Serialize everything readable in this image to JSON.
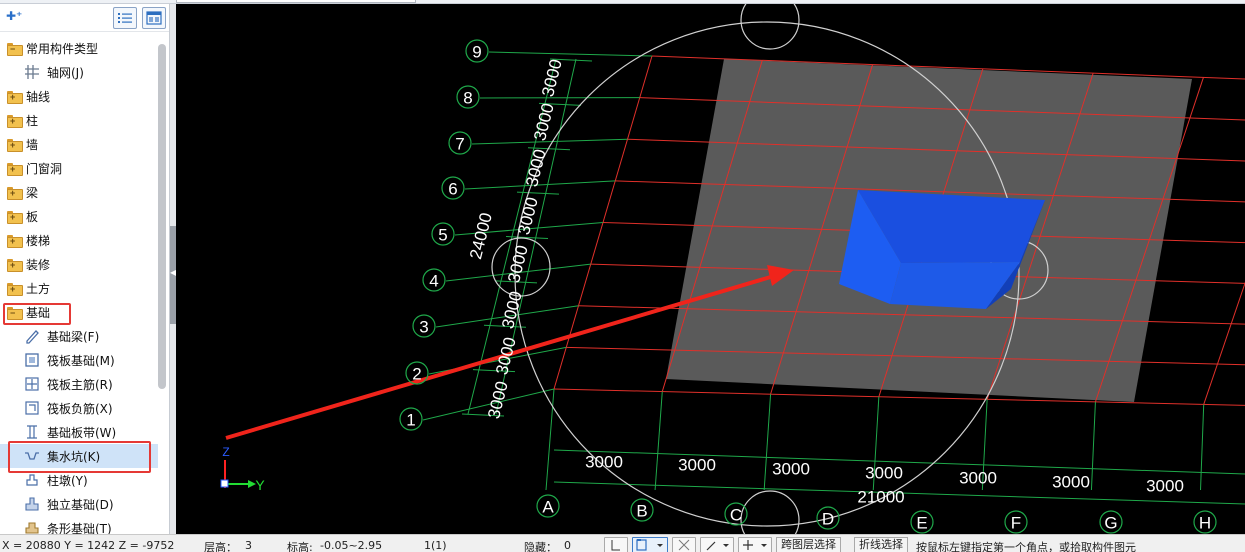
{
  "tree": {
    "items": [
      {
        "label": "常用构件类型",
        "icon": "folder-open-icon"
      },
      {
        "label": "轴网(J)",
        "icon": "grid-icon"
      },
      {
        "label": "轴线",
        "icon": "folder-icon"
      },
      {
        "label": "柱",
        "icon": "folder-icon"
      },
      {
        "label": "墙",
        "icon": "folder-icon"
      },
      {
        "label": "门窗洞",
        "icon": "folder-icon"
      },
      {
        "label": "梁",
        "icon": "folder-icon"
      },
      {
        "label": "板",
        "icon": "folder-icon"
      },
      {
        "label": "楼梯",
        "icon": "folder-icon"
      },
      {
        "label": "装修",
        "icon": "folder-icon"
      },
      {
        "label": "土方",
        "icon": "folder-icon"
      },
      {
        "label": "基础",
        "icon": "folder-open-icon"
      },
      {
        "label": "基础梁(F)",
        "icon": "pencil-icon"
      },
      {
        "label": "筏板基础(M)",
        "icon": "raft-icon"
      },
      {
        "label": "筏板主筋(R)",
        "icon": "rebar-icon"
      },
      {
        "label": "筏板负筋(X)",
        "icon": "neg-rebar-icon"
      },
      {
        "label": "基础板带(W)",
        "icon": "strip-icon"
      },
      {
        "label": "集水坑(K)",
        "icon": "sump-icon"
      },
      {
        "label": "柱墩(Y)",
        "icon": "pier-icon"
      },
      {
        "label": "独立基础(D)",
        "icon": "isolated-footing-icon"
      },
      {
        "label": "条形基础(T)",
        "icon": "strip-footing-icon"
      }
    ],
    "selected": "集水坑(K)"
  },
  "viewport": {
    "row_axes": [
      "1",
      "2",
      "3",
      "4",
      "5",
      "6",
      "7",
      "8",
      "9"
    ],
    "col_axes": [
      "A",
      "B",
      "C",
      "D",
      "E",
      "F",
      "G",
      "H"
    ],
    "col_dims": [
      "3000",
      "3000",
      "3000",
      "3000",
      "3000",
      "3000",
      "3000"
    ],
    "col_total": "21000",
    "row_dims": [
      "3000",
      "3000",
      "3000",
      "3000",
      "3000",
      "3000",
      "3000",
      "3000"
    ],
    "row_total": "24000",
    "axis_labels": {
      "z": "Z",
      "y": "Y"
    },
    "colors": {
      "grid_red": "#e0302a",
      "grid_green": "#1fa84a",
      "slab": "#5a5a5a",
      "sump": "#1f5be8",
      "arrow": "#f0241b"
    }
  },
  "status": {
    "coords": "X = 20880 Y = 1242 Z = -9752",
    "floor_height_label": "层高：",
    "floor_height": "3",
    "elevation_label": "标高:",
    "elevation": "-0.05~2.95",
    "count": "1(1)",
    "hidden_label": "隐藏：",
    "hidden": "0",
    "btn_hide_layer": "跨图层选择",
    "btn_polyline": "折线选择",
    "hint": "按鼠标左键指定第一个角点，或拾取构件图元"
  }
}
